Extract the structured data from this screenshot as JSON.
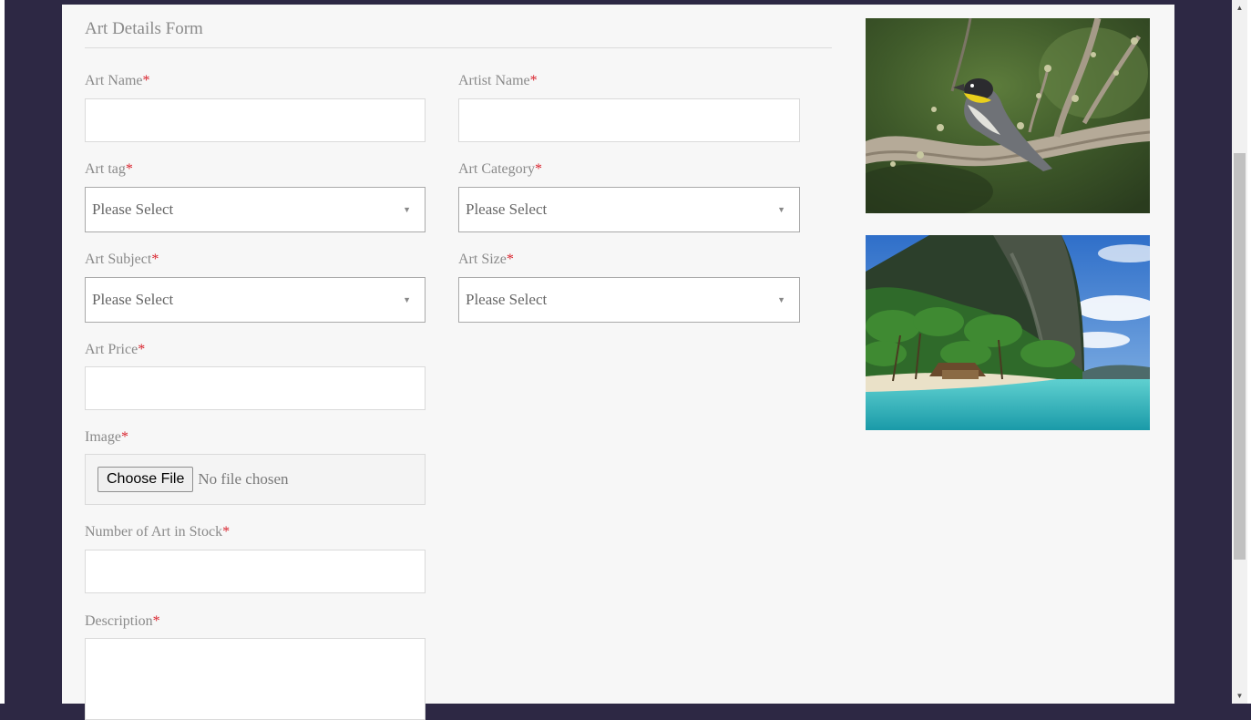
{
  "form": {
    "title": "Art Details Form",
    "required_mark": "*",
    "art_name": {
      "label": "Art Name",
      "value": ""
    },
    "artist_name": {
      "label": "Artist Name",
      "value": ""
    },
    "art_tag": {
      "label": "Art tag",
      "selected": "Please Select"
    },
    "art_category": {
      "label": "Art Category",
      "selected": "Please Select"
    },
    "art_subject": {
      "label": "Art Subject",
      "selected": "Please Select"
    },
    "art_size": {
      "label": "Art Size",
      "selected": "Please Select"
    },
    "art_price": {
      "label": "Art Price",
      "value": ""
    },
    "image": {
      "label": "Image",
      "button": "Choose File",
      "status": "No file chosen"
    },
    "stock": {
      "label": "Number of Art in Stock",
      "value": ""
    },
    "description": {
      "label": "Description",
      "value": ""
    }
  },
  "gallery": [
    {
      "subject": "bird perched on a branch"
    },
    {
      "subject": "tropical beach with a hut and cliffs"
    }
  ],
  "colors": {
    "frame": "#2d2844",
    "page": "#f7f7f7",
    "required": "#d9232d",
    "label": "#8a8a8a"
  },
  "icons": {
    "dropdown": "caret-down-icon",
    "scroll_up": "scroll-up-icon",
    "scroll_down": "scroll-down-icon"
  }
}
